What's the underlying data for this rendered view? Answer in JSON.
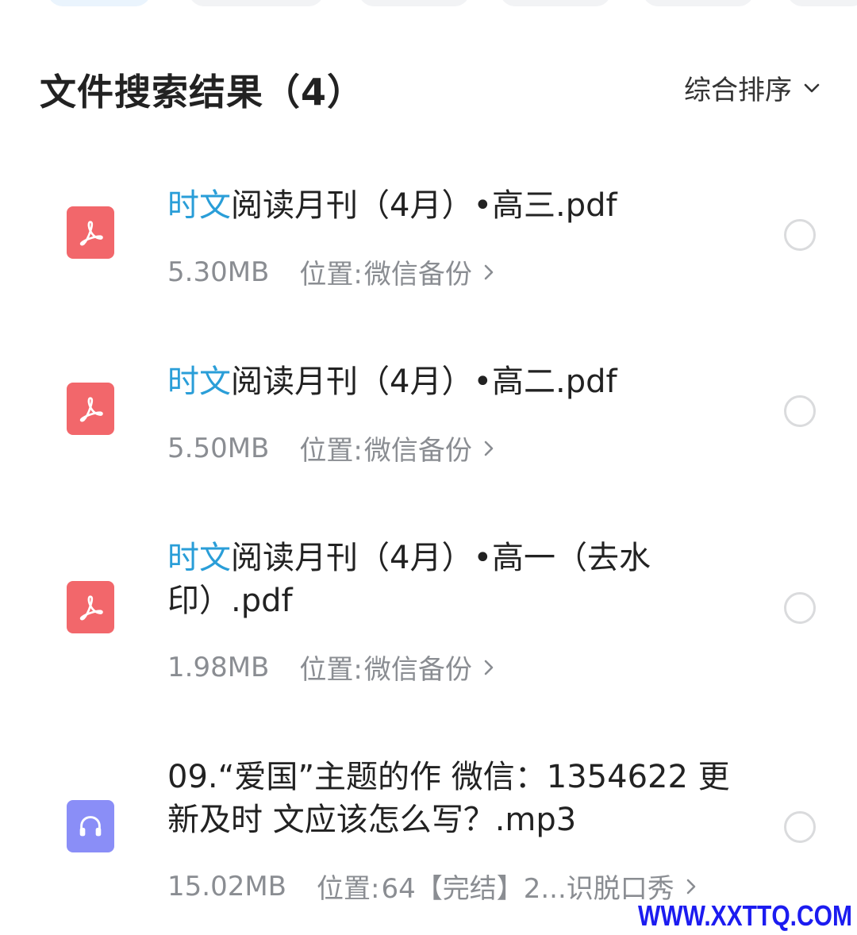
{
  "header": {
    "title": "文件搜索结果（4）",
    "sort_label": "综合排序"
  },
  "files": [
    {
      "type_icon": "pdf-icon",
      "name_highlight": "时文",
      "name_rest": "阅读月刊（4月）•高三.pdf",
      "size": "5.30MB",
      "location_label": "位置:",
      "location": "微信备份"
    },
    {
      "type_icon": "pdf-icon",
      "name_highlight": "时文",
      "name_rest": "阅读月刊（4月）•高二.pdf",
      "size": "5.50MB",
      "location_label": "位置:",
      "location": "微信备份"
    },
    {
      "type_icon": "pdf-icon",
      "name_highlight": "时文",
      "name_rest": "阅读月刊（4月）•高一（去水印）.pdf",
      "size": "1.98MB",
      "location_label": "位置:",
      "location": "微信备份"
    },
    {
      "type_icon": "headphones-icon",
      "name_highlight": "",
      "name_rest": "09.“爱国”主题的作 微信：1354622 更新及时 文应该怎么写？.mp3",
      "size": "15.02MB",
      "location_label": "位置:",
      "location": "64【完结】2...识脱口秀"
    }
  ],
  "watermark": "WWW.XXTTQ.COM",
  "colors": {
    "highlight": "#2a9ed8",
    "pdf_icon_bg": "#f2676b",
    "audio_icon_bg": "#8a8ef7",
    "meta_text": "#8a8d92",
    "watermark": "#1c1cf0"
  }
}
